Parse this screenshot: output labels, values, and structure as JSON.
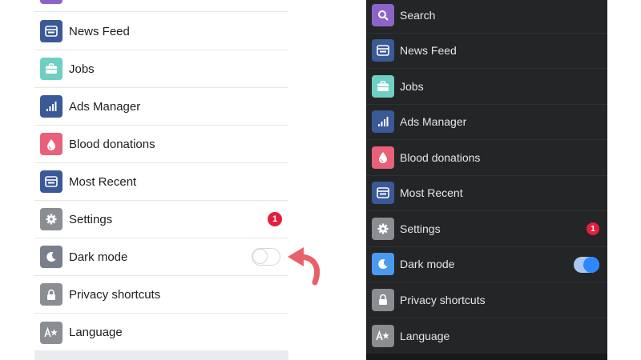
{
  "light_menu": {
    "items": [
      {
        "label": "",
        "icon": "search-icon",
        "color": "#8e63c9"
      },
      {
        "label": "News Feed",
        "icon": "news-feed-icon",
        "color": "#3b5998"
      },
      {
        "label": "Jobs",
        "icon": "briefcase-icon",
        "color": "#6fcfc2"
      },
      {
        "label": "Ads Manager",
        "icon": "bar-chart-icon",
        "color": "#3b5998"
      },
      {
        "label": "Blood donations",
        "icon": "blood-drop-icon",
        "color": "#e8607a"
      },
      {
        "label": "Most Recent",
        "icon": "news-feed-icon",
        "color": "#3b5998"
      },
      {
        "label": "Settings",
        "icon": "gear-icon",
        "color": "#8a8d91",
        "badge": "1"
      },
      {
        "label": "Dark mode",
        "icon": "moon-icon",
        "color": "#7a7f8c",
        "toggle": false
      },
      {
        "label": "Privacy shortcuts",
        "icon": "lock-icon",
        "color": "#8a8d91"
      },
      {
        "label": "Language",
        "icon": "translate-icon",
        "color": "#8a8d91"
      }
    ]
  },
  "dark_menu": {
    "items": [
      {
        "label": "Search",
        "icon": "search-icon",
        "color": "#8e63c9"
      },
      {
        "label": "News Feed",
        "icon": "news-feed-icon",
        "color": "#3b5998"
      },
      {
        "label": "Jobs",
        "icon": "briefcase-icon",
        "color": "#6fcfc2"
      },
      {
        "label": "Ads Manager",
        "icon": "bar-chart-icon",
        "color": "#3b5998"
      },
      {
        "label": "Blood donations",
        "icon": "blood-drop-icon",
        "color": "#e8607a"
      },
      {
        "label": "Most Recent",
        "icon": "news-feed-icon",
        "color": "#3b5998"
      },
      {
        "label": "Settings",
        "icon": "gear-icon",
        "color": "#8a8d91",
        "badge": "1"
      },
      {
        "label": "Dark mode",
        "icon": "moon-icon",
        "color": "#4a9bf0",
        "toggle": true
      },
      {
        "label": "Privacy shortcuts",
        "icon": "lock-icon",
        "color": "#8a8d91"
      },
      {
        "label": "Language",
        "icon": "translate-icon",
        "color": "#8a8d91"
      }
    ]
  },
  "annotation": {
    "icon": "curved-arrow-icon",
    "color": "#e8606a"
  }
}
